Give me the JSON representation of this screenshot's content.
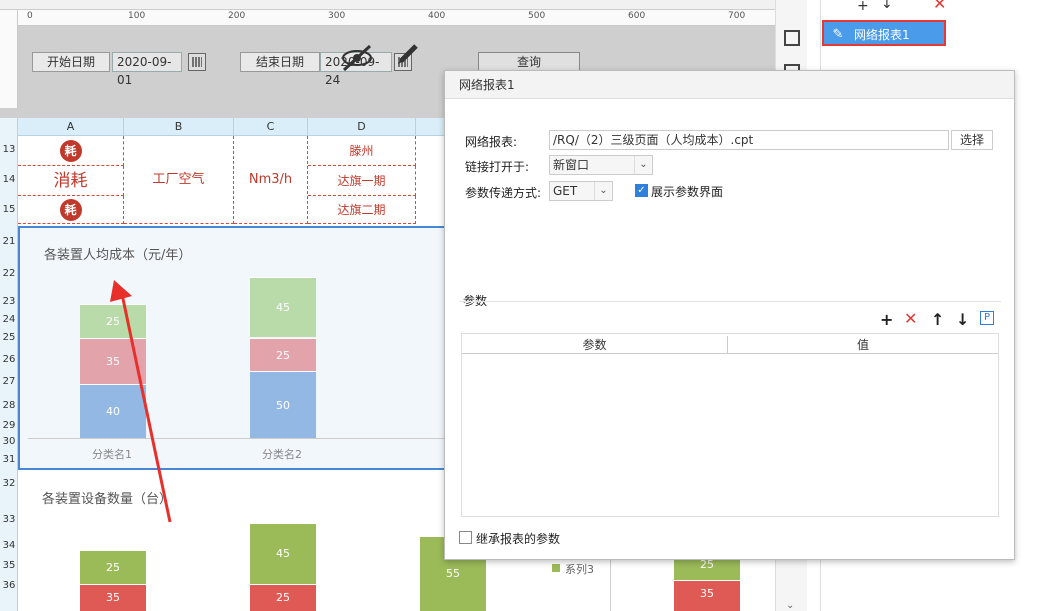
{
  "param_panel": {
    "start_label": "开始日期",
    "start_value": "2020-09-01",
    "end_label": "结束日期",
    "end_value": "2020-09-24",
    "query_label": "查询"
  },
  "ruler": {
    "ticks": [
      "0",
      "100",
      "200",
      "300",
      "400",
      "500",
      "600",
      "700"
    ]
  },
  "columns": [
    "A",
    "B",
    "C",
    "D"
  ],
  "rows": [
    "13",
    "14",
    "15",
    "21",
    "22",
    "23",
    "24",
    "25",
    "26",
    "27",
    "28",
    "29",
    "30",
    "31",
    "32",
    "33",
    "34",
    "35",
    "36"
  ],
  "cells": {
    "a13": "耗",
    "a14": "消耗",
    "a15": "耗",
    "b": "工厂空气",
    "c": "Nm3/h",
    "d13": "滕州",
    "d14": "达旗一期",
    "d15": "达旗二期"
  },
  "chart1": {
    "title": "各装置人均成本（元/年）",
    "categories": [
      "分类名1",
      "分类名2"
    ],
    "series": [
      {
        "values": [
          40,
          50
        ],
        "color": "#93b8e4"
      },
      {
        "values": [
          35,
          25
        ],
        "color": "#e3a3ab"
      },
      {
        "values": [
          25,
          45
        ],
        "color": "#b9dba9"
      }
    ]
  },
  "chart2": {
    "title": "各装置设备数量（台）",
    "bottom_values": [
      35,
      25,
      null,
      35
    ],
    "top_values": [
      25,
      45,
      55,
      25
    ],
    "legend_item": "系列3"
  },
  "right_panel": {
    "hyperlink_item": "网络报表1"
  },
  "dialog": {
    "title": "网络报表1",
    "report_label": "网络报表:",
    "report_value": "/RQ/（2）三级页面（人均成本）.cpt",
    "choose_label": "选择",
    "open_label": "链接打开于:",
    "open_value": "新窗口",
    "method_label": "参数传递方式:",
    "method_value": "GET",
    "show_param_label": "展示参数界面",
    "params_label": "参数",
    "col_param": "参数",
    "col_value": "值",
    "inherit_label": "继承报表的参数"
  }
}
